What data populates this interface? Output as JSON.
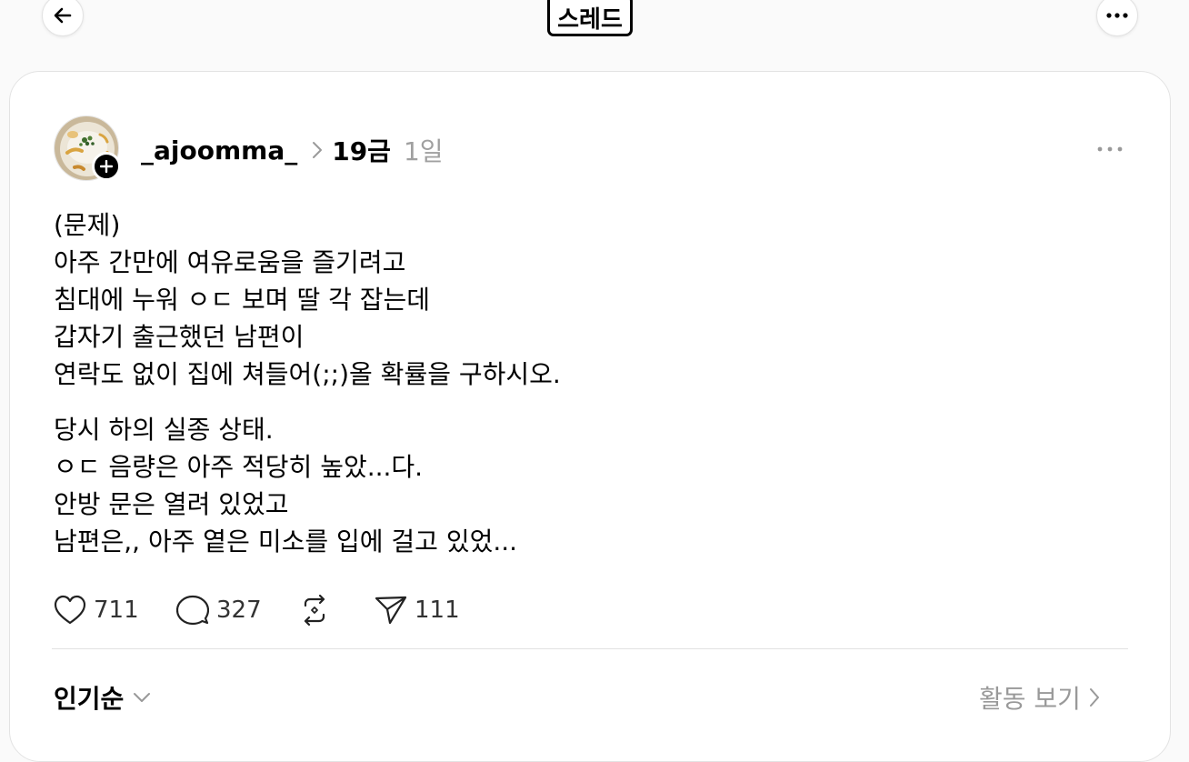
{
  "topbar": {
    "title": "스레드",
    "back_icon": "arrow-left-icon",
    "more_icon": "more-horizontal-icon"
  },
  "post": {
    "username": "_ajoomma_",
    "community": "19금",
    "time": "1일",
    "lines": [
      [
        "(문제)",
        "아주 간만에 여유로움을 즐기려고",
        "침대에 누워 ㅇㄷ 보며 딸 각 잡는데",
        "갑자기 출근했던 남편이",
        "연락도 없이 집에 쳐들어(;;)올 확률을 구하시오."
      ],
      [
        "당시 하의 실종 상태.",
        "ㅇㄷ 음량은 아주 적당히 높았...다.",
        "안방 문은 열려 있었고",
        "남편은,, 아주 옅은 미소를 입에 걸고 있었..."
      ]
    ],
    "stats": {
      "likes": "711",
      "replies": "327",
      "shares": "111"
    }
  },
  "replies_bar": {
    "sort_label": "인기순",
    "activity_label": "활동 보기"
  }
}
